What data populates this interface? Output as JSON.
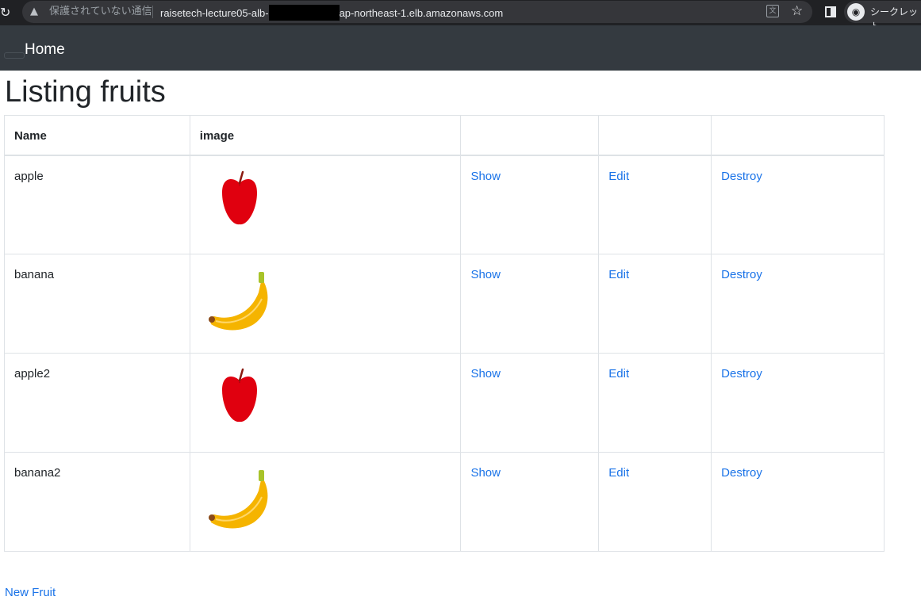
{
  "browser": {
    "reload_icon": "reload-icon",
    "insecure_label": "保護されていない通信",
    "url_prefix": "raisetech-lecture05-alb-",
    "url_suffix": "ap-northeast-1.elb.amazonaws.com",
    "incognito_label": "シークレット"
  },
  "navbar": {
    "brand": "Home"
  },
  "page": {
    "title": "Listing fruits",
    "new_link": "New Fruit"
  },
  "table": {
    "headers": [
      "Name",
      "image",
      "",
      "",
      ""
    ],
    "rows": [
      {
        "name": "apple",
        "image": "apple",
        "show": "Show",
        "edit": "Edit",
        "destroy": "Destroy"
      },
      {
        "name": "banana",
        "image": "banana",
        "show": "Show",
        "edit": "Edit",
        "destroy": "Destroy"
      },
      {
        "name": "apple2",
        "image": "apple",
        "show": "Show",
        "edit": "Edit",
        "destroy": "Destroy"
      },
      {
        "name": "banana2",
        "image": "banana",
        "show": "Show",
        "edit": "Edit",
        "destroy": "Destroy"
      }
    ]
  },
  "colors": {
    "navbar_bg": "#343a40",
    "link": "#1a73e8",
    "apple_red": "#e0000f",
    "banana_yellow": "#f5b400"
  }
}
